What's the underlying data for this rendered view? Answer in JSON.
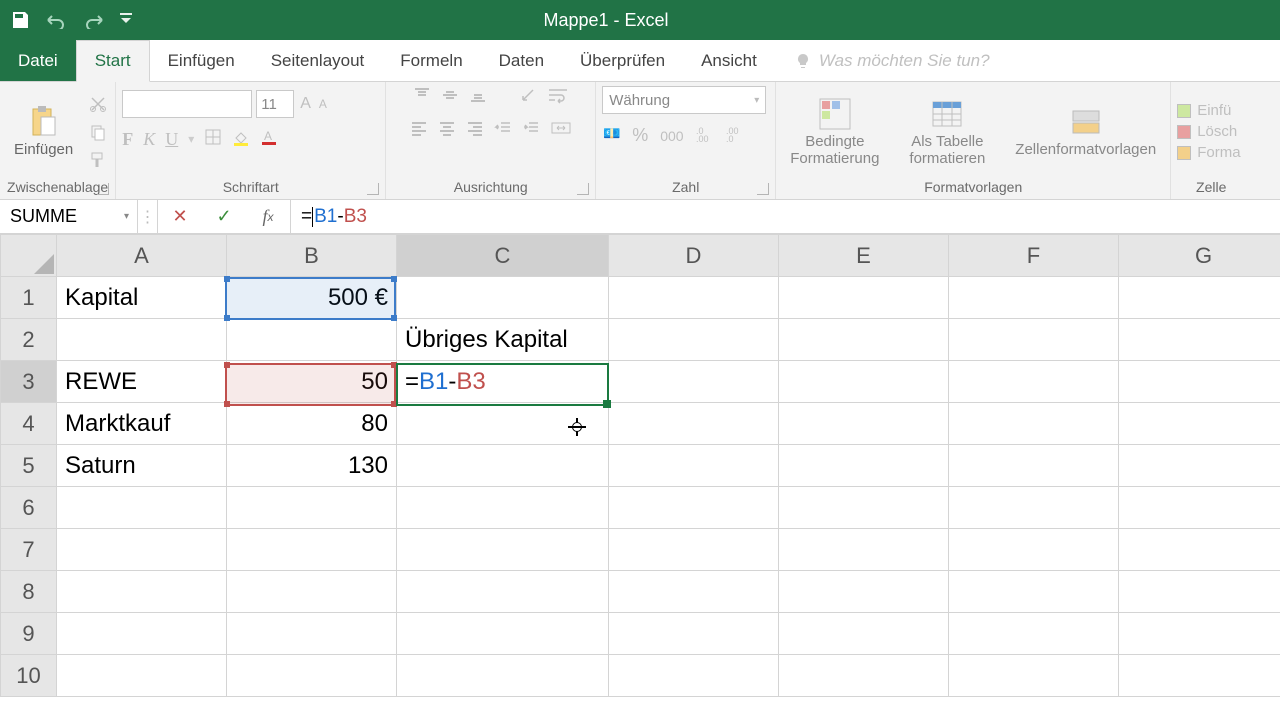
{
  "titlebar": {
    "title": "Mappe1 - Excel"
  },
  "tabs": {
    "file": "Datei",
    "home": "Start",
    "insert": "Einfügen",
    "layout": "Seitenlayout",
    "formulas": "Formeln",
    "data": "Daten",
    "review": "Überprüfen",
    "view": "Ansicht",
    "tellme_placeholder": "Was möchten Sie tun?"
  },
  "ribbon": {
    "clipboard": {
      "label": "Zwischenablage",
      "paste": "Einfügen"
    },
    "font": {
      "label": "Schriftart",
      "size": "11"
    },
    "alignment": {
      "label": "Ausrichtung"
    },
    "number": {
      "label": "Zahl",
      "format": "Währung"
    },
    "styles": {
      "label": "Formatvorlagen",
      "cond": "Bedingte\nFormatierung",
      "table": "Als Tabelle\nformatieren",
      "cellstyles": "Zellenformatvorlagen"
    },
    "cells": {
      "label": "Zelle",
      "insert": "Einfü",
      "delete": "Lösch",
      "format": "Forma"
    }
  },
  "formula_bar": {
    "name_box": "SUMME",
    "formula_eq": "=",
    "formula_ref1": "B1",
    "formula_minus": "-",
    "formula_ref2": "B3"
  },
  "columns": [
    "A",
    "B",
    "C",
    "D",
    "E",
    "F",
    "G"
  ],
  "rows": [
    "1",
    "2",
    "3",
    "4",
    "5",
    "6",
    "7",
    "8",
    "9",
    "10"
  ],
  "cells": {
    "A1": "Kapital",
    "B1": "500 €",
    "C2": "Übriges Kapital",
    "A3": "REWE",
    "B3": "50",
    "C3_eq": "=",
    "C3_ref1": "B1",
    "C3_minus": "-",
    "C3_ref2": "B3",
    "A4": "Marktkauf",
    "B4": "80",
    "A5": "Saturn",
    "B5": "130"
  },
  "active_col": "C",
  "active_row": "3"
}
